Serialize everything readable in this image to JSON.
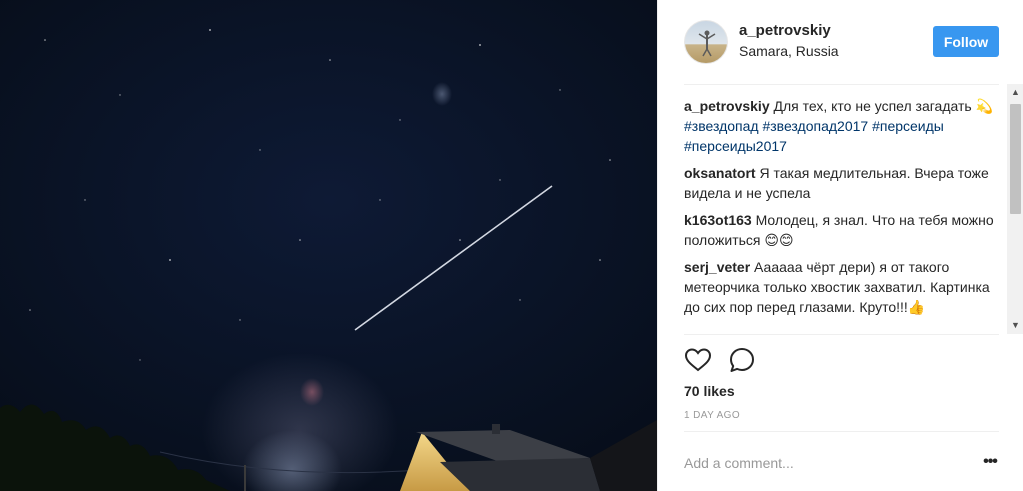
{
  "post": {
    "username": "a_petrovskiy",
    "location": "Samara, Russia",
    "follow_label": "Follow",
    "likes": "70 likes",
    "time": "1 day ago",
    "add_comment_placeholder": "Add a comment...",
    "more_label": "•••",
    "caption": {
      "user": "a_petrovskiy",
      "text": " Для тех, кто не успел загадать 💫 ",
      "tags": [
        "#звездопад",
        "#звездопад2017",
        "#персеиды",
        "#персеиды2017"
      ]
    }
  },
  "comments": [
    {
      "user": "oksanatort",
      "text": " Я такая медлительная. Вчера тоже видела и не успела"
    },
    {
      "user": "k163ot163",
      "text": " Молодец, я знал. Что на тебя можно положиться 😊😊"
    },
    {
      "user": "serj_veter",
      "text": " Аааааа чёрт дери) я от такого метеорчика только хвостик захватил. Картинка до сих пор перед глазами. Круто!!!👍"
    }
  ],
  "icons": {
    "like": "heart-icon",
    "comment": "comment-bubble-icon",
    "more": "more-options-icon"
  },
  "colors": {
    "follow_button": "#3897f0",
    "hashtag": "#003569",
    "timestamp": "#999999"
  }
}
